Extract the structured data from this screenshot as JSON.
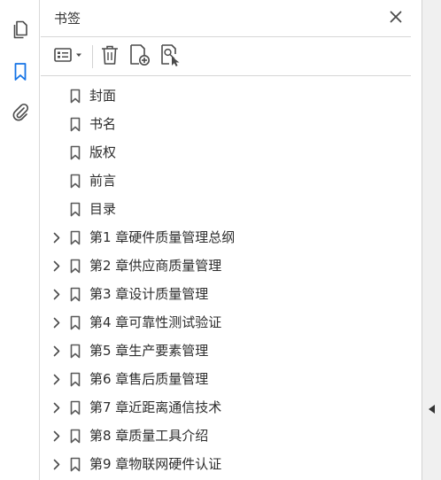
{
  "panel": {
    "title": "书签"
  },
  "rail": {
    "items": [
      {
        "name": "pages-thumbnail-icon",
        "active": false
      },
      {
        "name": "bookmark-icon",
        "active": true
      },
      {
        "name": "attachment-icon",
        "active": false
      }
    ]
  },
  "toolbar": {
    "items": [
      "options-menu-icon",
      "delete-icon",
      "new-bookmark-icon",
      "find-bookmark-icon"
    ]
  },
  "colors": {
    "accent": "#1473e6",
    "icon": "#4b4b4b",
    "divider": "#d6d6d6"
  },
  "bookmarks": [
    {
      "label": "封面",
      "expandable": false
    },
    {
      "label": "书名",
      "expandable": false
    },
    {
      "label": "版权",
      "expandable": false
    },
    {
      "label": "前言",
      "expandable": false
    },
    {
      "label": "目录",
      "expandable": false
    },
    {
      "label": "第1 章硬件质量管理总纲",
      "expandable": true
    },
    {
      "label": "第2 章供应商质量管理",
      "expandable": true
    },
    {
      "label": "第3 章设计质量管理",
      "expandable": true
    },
    {
      "label": "第4 章可靠性测试验证",
      "expandable": true
    },
    {
      "label": "第5 章生产要素管理",
      "expandable": true
    },
    {
      "label": "第6 章售后质量管理",
      "expandable": true
    },
    {
      "label": "第7 章近距离通信技术",
      "expandable": true
    },
    {
      "label": "第8 章质量工具介绍",
      "expandable": true
    },
    {
      "label": "第9 章物联网硬件认证",
      "expandable": true
    }
  ]
}
